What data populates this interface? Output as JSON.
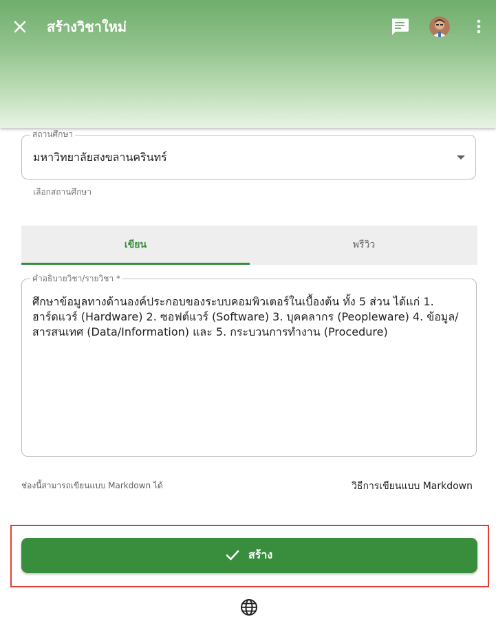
{
  "header": {
    "title": "สร้างวิชาใหม่",
    "icons": [
      "close-icon",
      "chat-icon",
      "avatar",
      "more-vert-icon"
    ]
  },
  "form": {
    "institution": {
      "label": "สถานศึกษา",
      "value": "มหาวิทยาลัยสงขลานครินทร์",
      "helper": "เลือกสถานศึกษา"
    },
    "tabs": [
      {
        "label": "เขียน",
        "active": true
      },
      {
        "label": "พรีวิว",
        "active": false
      }
    ],
    "description": {
      "label": "คำอธิบายวิชา/รายวิชา *",
      "value": "ศึกษาข้อมูลทางด้านองค์ประกอบของระบบคอมพิวเตอร์ในเบื้องต้น ทั้ง 5 ส่วน ได้แก่ 1. ฮาร์ดแวร์ (Hardware) 2. ซอฟต์แวร์ (Software)  3. บุคคลากร (Peopleware) 4. ข้อมูล/สารสนเทศ (Data/Information) และ 5. กระบวนการทำงาน (Procedure)"
    },
    "markdown_hint": "ช่องนี้สามารถเขียนแบบ Markdown ได้",
    "markdown_link": "วิธีการเขียนแบบ Markdown"
  },
  "actions": {
    "create_label": "สร้าง",
    "create_icon": "check-icon"
  },
  "footer": {
    "icon": "globe-icon"
  },
  "colors": {
    "primary": "#388e3c",
    "header_gradient_top": "#6fae6c",
    "highlight": "#e53935"
  }
}
